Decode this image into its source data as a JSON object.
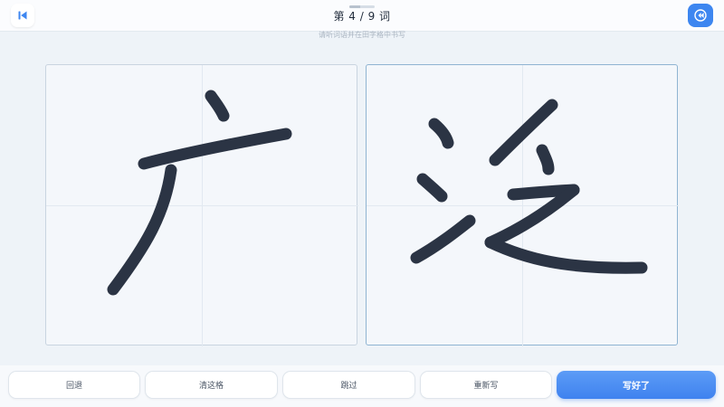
{
  "header": {
    "progress_text": "第 4 / 9 词",
    "progress_fraction": 0.44,
    "back_icon": "skip-back-icon",
    "audio_icon": "audio-replay-icon"
  },
  "instruction": "请听词语并在田字格中书写",
  "grids": [
    {
      "character": "广"
    },
    {
      "character": "泛"
    }
  ],
  "buttons": {
    "back": "回退",
    "clear": "清这格",
    "skip": "跳过",
    "rewrite": "重新写",
    "done": "写好了"
  },
  "colors": {
    "accent": "#3d86f0",
    "ink": "#2b3444",
    "grid_border": "#c9d4e0",
    "active_grid_border": "#8fb4d2"
  }
}
